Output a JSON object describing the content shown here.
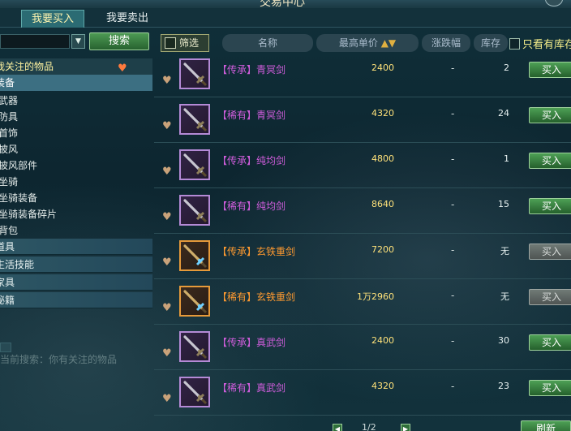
{
  "window": {
    "title": "交易中心"
  },
  "tabs": {
    "buy": "我要买入",
    "sell": "我要卖出"
  },
  "search": {
    "placeholder": "",
    "button": "搜索"
  },
  "categories": {
    "favorites": "我关注的物品",
    "equipment_header": "装备",
    "items": [
      "武器",
      "防具",
      "首饰",
      "披风",
      "披风部件",
      "坐骑",
      "坐骑装备",
      "坐骑装备碎片",
      "背包"
    ],
    "other": [
      "道具",
      "生活技能",
      "家具",
      "秘籍"
    ]
  },
  "tip": "当前搜索：你有关注的物品",
  "table_header": {
    "filter": "筛选",
    "name": "名称",
    "max_price": "最高单价",
    "change": "涨跌幅",
    "stock": "库存",
    "only_in_stock": "只看有库存"
  },
  "rows": [
    {
      "tag": "【传承】",
      "name": "青冥剑",
      "price": "2400",
      "change": "-",
      "stock": "2",
      "buy": "买入",
      "buy_enabled": true,
      "icon": "sword-icon",
      "rarity": "purple"
    },
    {
      "tag": "【稀有】",
      "name": "青冥剑",
      "price": "4320",
      "change": "-",
      "stock": "24",
      "buy": "买入",
      "buy_enabled": true,
      "icon": "sword-icon",
      "rarity": "purple"
    },
    {
      "tag": "【传承】",
      "name": "纯均剑",
      "price": "4800",
      "change": "-",
      "stock": "1",
      "buy": "买入",
      "buy_enabled": true,
      "icon": "sword-icon",
      "rarity": "purple"
    },
    {
      "tag": "【稀有】",
      "name": "纯均剑",
      "price": "8640",
      "change": "-",
      "stock": "15",
      "buy": "买入",
      "buy_enabled": true,
      "icon": "sword-icon",
      "rarity": "purple"
    },
    {
      "tag": "【传承】",
      "name": "玄铁重剑",
      "price": "7200",
      "change": "-",
      "stock": "无",
      "buy": "买入",
      "buy_enabled": false,
      "icon": "heavy-sword-icon",
      "rarity": "orange"
    },
    {
      "tag": "【稀有】",
      "name": "玄铁重剑",
      "price": "1万2960",
      "change": "-",
      "stock": "无",
      "buy": "买入",
      "buy_enabled": false,
      "icon": "heavy-sword-icon",
      "rarity": "orange"
    },
    {
      "tag": "【传承】",
      "name": "真武剑",
      "price": "2400",
      "change": "-",
      "stock": "30",
      "buy": "买入",
      "buy_enabled": true,
      "icon": "sword-icon",
      "rarity": "purple"
    },
    {
      "tag": "【稀有】",
      "name": "真武剑",
      "price": "4320",
      "change": "-",
      "stock": "23",
      "buy": "买入",
      "buy_enabled": true,
      "icon": "sword-icon",
      "rarity": "purple"
    }
  ],
  "pager": {
    "page": "1/2"
  },
  "refresh": "刷新"
}
